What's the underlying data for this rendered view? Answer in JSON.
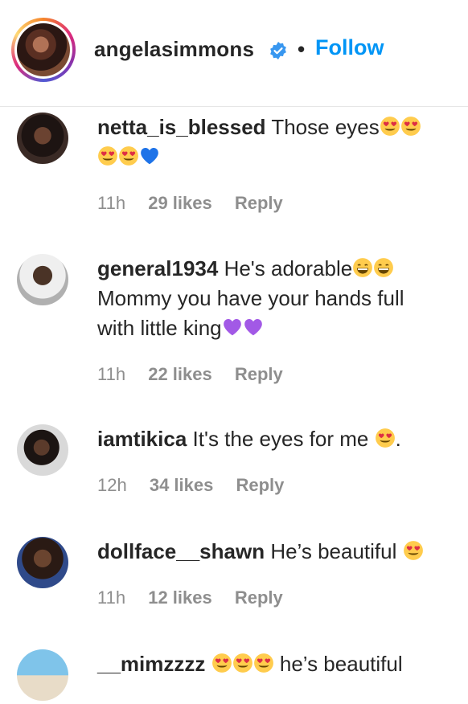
{
  "post": {
    "username": "angelasimmons",
    "separator": "•",
    "follow_label": "Follow"
  },
  "comments": [
    {
      "username": "netta_is_blessed",
      "text": "Those eyes",
      "emojis_after": [
        "heart-eyes",
        "heart-eyes",
        "heart-eyes",
        "heart-eyes",
        "blue-heart"
      ],
      "time": "11h",
      "likes": "29 likes",
      "reply": "Reply"
    },
    {
      "username": "general1934",
      "text": "He's adorable",
      "line2": "Mommy you have your hands full",
      "line3": "with little king",
      "emojis_after": [
        "grin",
        "grin"
      ],
      "emojis_line3": [
        "purple-heart",
        "purple-heart"
      ],
      "time": "11h",
      "likes": "22 likes",
      "reply": "Reply"
    },
    {
      "username": "iamtikica",
      "text": "It's the eyes for me",
      "tail": ".",
      "emojis_after": [
        "heart-eyes"
      ],
      "time": "12h",
      "likes": "34 likes",
      "reply": "Reply"
    },
    {
      "username": "dollface__shawn",
      "text": "He’s beautiful",
      "emojis_after": [
        "heart-eyes"
      ],
      "time": "11h",
      "likes": "12 likes",
      "reply": "Reply"
    },
    {
      "username": "__mimzzzz",
      "text": "he’s beautiful",
      "emojis_before": [
        "heart-eyes",
        "heart-eyes",
        "heart-eyes"
      ]
    }
  ],
  "colors": {
    "accent": "#0095f6",
    "meta": "#8e8e8e",
    "text": "#262626"
  }
}
